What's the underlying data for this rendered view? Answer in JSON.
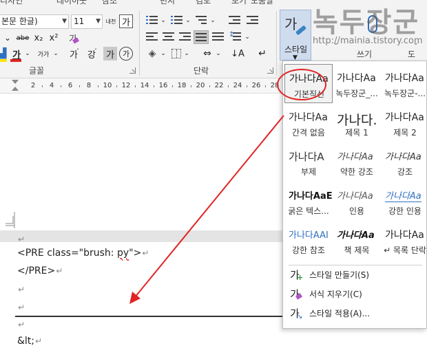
{
  "menu_tabs": [
    "디자인",
    "레이아웃",
    "참조",
    "편지",
    "검토",
    "보기",
    "도움말"
  ],
  "font": {
    "name": "본문 한글)",
    "size": "11"
  },
  "font_group_label": "글꼴",
  "paragraph_group_label": "단락",
  "font_buttons": {
    "grow": "내천",
    "hangul_box": "가",
    "strike": "abe",
    "subscript": "x₂",
    "superscript": "x²",
    "change_case": "가",
    "emphasis": "강",
    "font_color": "가",
    "char_spacing": "가가",
    "phonetic": "가",
    "char_shading": "가",
    "enclose": "㉮"
  },
  "styles_button": {
    "glyph": "가",
    "label": "스타일"
  },
  "right_group_labels": [
    "쓰기",
    "도"
  ],
  "watermark": {
    "text": "녹두장군",
    "url": "http://mainia.tistory.com"
  },
  "ruler_numbers": [
    "2",
    "4",
    "6",
    "8",
    "10",
    "12",
    "14",
    "16",
    "18",
    "20",
    "22",
    "24",
    "26",
    "28"
  ],
  "document": {
    "lines": [
      {
        "text_before": "<PRE class=\"brush: ",
        "squiggle": "py",
        "text_after": "\">"
      },
      {
        "text": "</PRE>"
      },
      {
        "text": ""
      },
      {
        "text": ""
      },
      {
        "text": ""
      },
      {
        "text": "&lt;"
      }
    ],
    "paragraph_mark": "↵"
  },
  "gallery": {
    "tiles": [
      {
        "sample": "가나다Aa",
        "name": "기본직선"
      },
      {
        "sample": "가나다Aa",
        "name": "녹두장군_..."
      },
      {
        "sample": "가나다Aa",
        "name": "녹두장군-..."
      },
      {
        "sample": "가나다Aa",
        "name": "간격 없음"
      },
      {
        "sample": "가나다.",
        "name": "제목 1"
      },
      {
        "sample": "가나다Aa",
        "name": "제목 2"
      },
      {
        "sample": "가나다A",
        "name": "부제"
      },
      {
        "sample": "가나다Aa",
        "name": "약한 강조"
      },
      {
        "sample": "가나다Aa",
        "name": "강조"
      },
      {
        "sample": "가나다AaE",
        "name": "굵은 텍스..."
      },
      {
        "sample": "가나다Aa",
        "name": "인용"
      },
      {
        "sample": "가나다Aa",
        "name": "강한 인용"
      },
      {
        "sample": "가나다AAI",
        "name": "강한 참조"
      },
      {
        "sample": "가나다Aa",
        "name": "책 제목"
      },
      {
        "sample": "가나다Aa",
        "name": "↵ 목록 단락"
      }
    ],
    "menu": [
      {
        "icon": "create-style-icon",
        "label": "스타일 만들기(S)"
      },
      {
        "icon": "clear-format-icon",
        "label": "서식 지우기(C)"
      },
      {
        "icon": "apply-style-icon",
        "label": "스타일 적용(A)..."
      }
    ]
  },
  "colors": {
    "accent_blue": "#2f6fbf",
    "annotation_red": "#e02424",
    "font_color_bar": "#e02424",
    "highlight_bar": "#ffe600"
  }
}
